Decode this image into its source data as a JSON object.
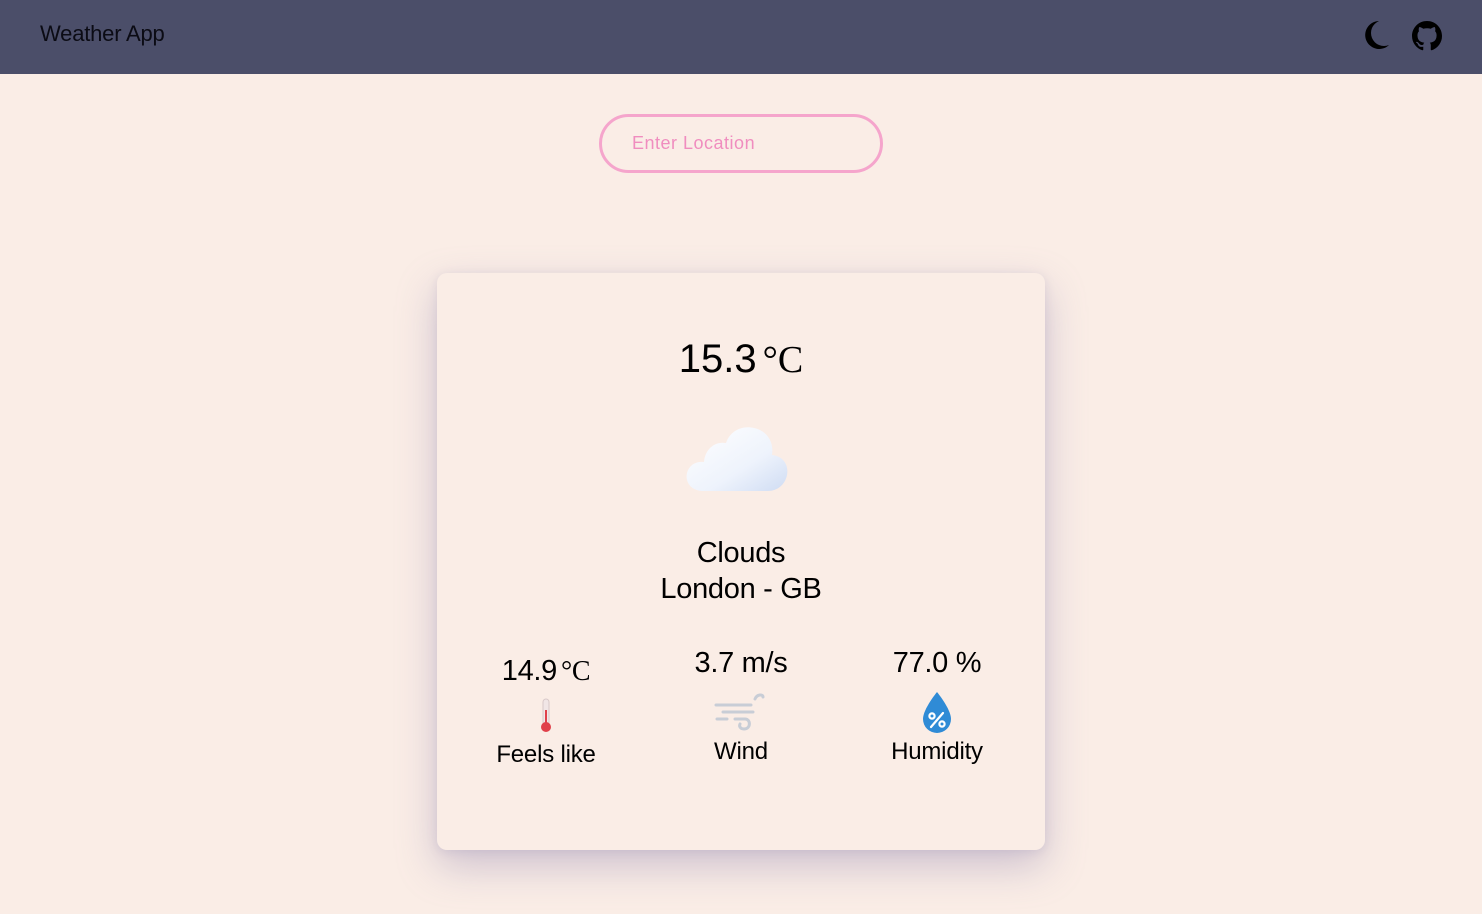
{
  "navbar": {
    "title": "Weather App",
    "icons": [
      "moon-icon",
      "github-icon"
    ],
    "background": "#4b4e69"
  },
  "search": {
    "placeholder": "Enter Location",
    "value": "",
    "border_color": "#f5a5cc"
  },
  "weather": {
    "temperature": "15.3",
    "temperature_unit": "°C",
    "icon": "cloud-icon",
    "condition": "Clouds",
    "location": "London - GB",
    "stats": {
      "feels_like": {
        "value": "14.9",
        "unit": "°C",
        "label": "Feels like",
        "icon": "thermometer-icon"
      },
      "wind": {
        "value": "3.7 m/s",
        "label": "Wind",
        "icon": "wind-icon"
      },
      "humidity": {
        "value": "77.0 %",
        "label": "Humidity",
        "icon": "humidity-drop-icon"
      }
    }
  },
  "colors": {
    "page_background": "#faede6",
    "accent_pink": "#f5a5cc",
    "humidity_blue": "#2f8bd6",
    "thermometer_red": "#e0404a"
  }
}
